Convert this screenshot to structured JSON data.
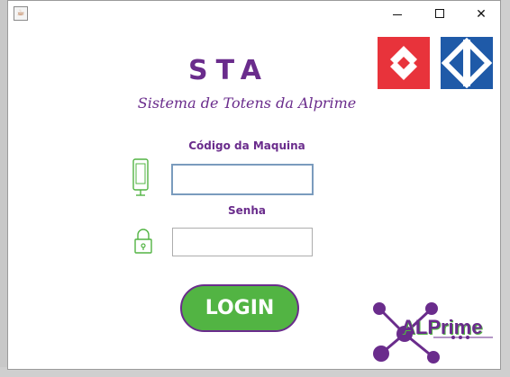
{
  "app": {
    "title": "STA",
    "subtitle": "Sistema de Totens da Alprime"
  },
  "window_controls": {
    "minimize_icon": "minimize-icon",
    "maximize_icon": "maximize-icon",
    "close_icon": "close-icon",
    "close_glyph": "✕"
  },
  "form": {
    "machine_code_label": "Código da Maquina",
    "machine_code_value": "",
    "password_label": "Senha",
    "password_value": ""
  },
  "login_button": {
    "label": "LOGIN"
  },
  "branding": {
    "alprime_text": "ALPrime"
  },
  "colors": {
    "accent_purple": "#6a2c8c",
    "accent_green": "#52b443",
    "logo_red": "#e8333b",
    "logo_blue": "#1f5aa8"
  },
  "icons": [
    "java-app-icon",
    "phone-icon",
    "lock-icon",
    "cptm-logo",
    "metro-logo",
    "alprime-logo"
  ]
}
